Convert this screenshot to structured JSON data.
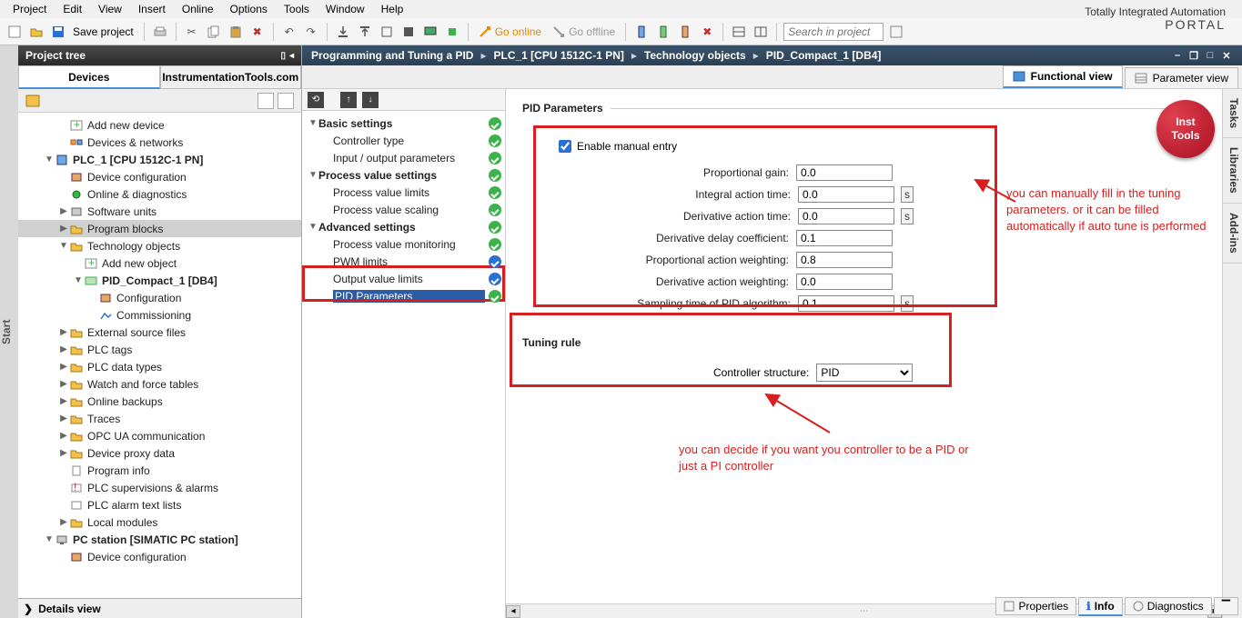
{
  "brand": {
    "line1": "Totally Integrated Automation",
    "line2": "PORTAL"
  },
  "menu": {
    "project": "Project",
    "edit": "Edit",
    "view": "View",
    "insert": "Insert",
    "online": "Online",
    "options": "Options",
    "tools": "Tools",
    "window": "Window",
    "help": "Help"
  },
  "toolbar": {
    "save": "Save project",
    "go_online": "Go online",
    "go_offline": "Go offline",
    "search_ph": "Search in project"
  },
  "project_tree": {
    "title": "Project tree",
    "tabs": {
      "devices": "Devices",
      "inst": "InstrumentationTools.com"
    },
    "items": [
      {
        "indent": 2,
        "tw": "",
        "icon": "add",
        "label": "Add new device",
        "i": true
      },
      {
        "indent": 2,
        "tw": "",
        "icon": "net",
        "label": "Devices & networks",
        "i": true
      },
      {
        "indent": 1,
        "tw": "▼",
        "icon": "plc",
        "label": "PLC_1 [CPU 1512C-1 PN]",
        "bold": true,
        "i": true
      },
      {
        "indent": 2,
        "tw": "",
        "icon": "cfg",
        "label": "Device configuration",
        "i": true
      },
      {
        "indent": 2,
        "tw": "",
        "icon": "diag",
        "label": "Online & diagnostics",
        "i": true
      },
      {
        "indent": 2,
        "tw": "▶",
        "icon": "sw",
        "label": "Software units",
        "i": true
      },
      {
        "indent": 2,
        "tw": "▶",
        "icon": "folder",
        "label": "Program blocks",
        "sel": true,
        "i": true
      },
      {
        "indent": 2,
        "tw": "▼",
        "icon": "folder",
        "label": "Technology objects",
        "i": true
      },
      {
        "indent": 3,
        "tw": "",
        "icon": "add",
        "label": "Add new object",
        "i": true
      },
      {
        "indent": 3,
        "tw": "▼",
        "icon": "pid",
        "label": "PID_Compact_1 [DB4]",
        "bold": true,
        "i": true
      },
      {
        "indent": 4,
        "tw": "",
        "icon": "cfg",
        "label": "Configuration",
        "i": true
      },
      {
        "indent": 4,
        "tw": "",
        "icon": "com",
        "label": "Commissioning",
        "i": true
      },
      {
        "indent": 2,
        "tw": "▶",
        "icon": "folder",
        "label": "External source files",
        "i": true
      },
      {
        "indent": 2,
        "tw": "▶",
        "icon": "folder",
        "label": "PLC tags",
        "i": true
      },
      {
        "indent": 2,
        "tw": "▶",
        "icon": "folder",
        "label": "PLC data types",
        "i": true
      },
      {
        "indent": 2,
        "tw": "▶",
        "icon": "folder",
        "label": "Watch and force tables",
        "i": true
      },
      {
        "indent": 2,
        "tw": "▶",
        "icon": "folder",
        "label": "Online backups",
        "i": true
      },
      {
        "indent": 2,
        "tw": "▶",
        "icon": "folder",
        "label": "Traces",
        "i": true
      },
      {
        "indent": 2,
        "tw": "▶",
        "icon": "folder",
        "label": "OPC UA communication",
        "i": true
      },
      {
        "indent": 2,
        "tw": "▶",
        "icon": "folder",
        "label": "Device proxy data",
        "i": true
      },
      {
        "indent": 2,
        "tw": "",
        "icon": "info",
        "label": "Program info",
        "i": true
      },
      {
        "indent": 2,
        "tw": "",
        "icon": "sup",
        "label": "PLC supervisions & alarms",
        "i": true
      },
      {
        "indent": 2,
        "tw": "",
        "icon": "alarm",
        "label": "PLC alarm text lists",
        "i": true
      },
      {
        "indent": 2,
        "tw": "▶",
        "icon": "folder",
        "label": "Local modules",
        "i": true
      },
      {
        "indent": 1,
        "tw": "▼",
        "icon": "pc",
        "label": "PC station [SIMATIC PC station]",
        "bold": true,
        "i": true
      },
      {
        "indent": 2,
        "tw": "",
        "icon": "cfg",
        "label": "Device configuration",
        "i": true
      }
    ]
  },
  "details": {
    "label": "Details view"
  },
  "crumb": {
    "p1": "Programming and Tuning a PID",
    "p2": "PLC_1 [CPU 1512C-1 PN]",
    "p3": "Technology objects",
    "p4": "PID_Compact_1 [DB4]"
  },
  "viewtabs": {
    "func": "Functional view",
    "param": "Parameter view"
  },
  "cfg": {
    "items": [
      {
        "indent": 0,
        "tw": "▼",
        "label": "Basic settings",
        "bold": true,
        "stat": "g"
      },
      {
        "indent": 1,
        "tw": "",
        "label": "Controller type",
        "stat": "g"
      },
      {
        "indent": 1,
        "tw": "",
        "label": "Input / output parameters",
        "stat": "g"
      },
      {
        "indent": 0,
        "tw": "▼",
        "label": "Process value settings",
        "bold": true,
        "stat": "g"
      },
      {
        "indent": 1,
        "tw": "",
        "label": "Process value limits",
        "stat": "g"
      },
      {
        "indent": 1,
        "tw": "",
        "label": "Process value scaling",
        "stat": "g"
      },
      {
        "indent": 0,
        "tw": "▼",
        "label": "Advanced settings",
        "bold": true,
        "stat": "g"
      },
      {
        "indent": 1,
        "tw": "",
        "label": "Process value monitoring",
        "stat": "g"
      },
      {
        "indent": 1,
        "tw": "",
        "label": "PWM limits",
        "stat": "b"
      },
      {
        "indent": 1,
        "tw": "",
        "label": "Output value limits",
        "stat": "b"
      },
      {
        "indent": 1,
        "tw": "",
        "label": "PID Parameters",
        "stat": "g",
        "sel": true
      }
    ]
  },
  "content": {
    "section_title": "PID Parameters",
    "enable_manual": "Enable manual entry",
    "enable_manual_checked": true,
    "fields": [
      {
        "label": "Proportional gain:",
        "value": "0.0",
        "unit": ""
      },
      {
        "label": "Integral action time:",
        "value": "0.0",
        "unit": "s"
      },
      {
        "label": "Derivative action time:",
        "value": "0.0",
        "unit": "s"
      },
      {
        "label": "Derivative delay coefficient:",
        "value": "0.1",
        "unit": ""
      },
      {
        "label": "Proportional action weighting:",
        "value": "0.8",
        "unit": ""
      },
      {
        "label": "Derivative action weighting:",
        "value": "0.0",
        "unit": ""
      },
      {
        "label": "Sampling time of PID algorithm:",
        "value": "0.1",
        "unit": "s"
      }
    ],
    "tuning_title": "Tuning rule",
    "controller_structure_label": "Controller structure:",
    "controller_structure_value": "PID"
  },
  "annotations": {
    "a1": "you can manually fill in the tuning parameters. or it can be filled automatically if auto tune is performed",
    "a2": "you can decide if you want you controller to be a PID or just a PI controller"
  },
  "right_tabs": {
    "tasks": "Tasks",
    "libraries": "Libraries",
    "addins": "Add-ins"
  },
  "bottom": {
    "properties": "Properties",
    "info": "Info",
    "diagnostics": "Diagnostics"
  },
  "badge": {
    "l1": "Inst",
    "l2": "Tools"
  }
}
